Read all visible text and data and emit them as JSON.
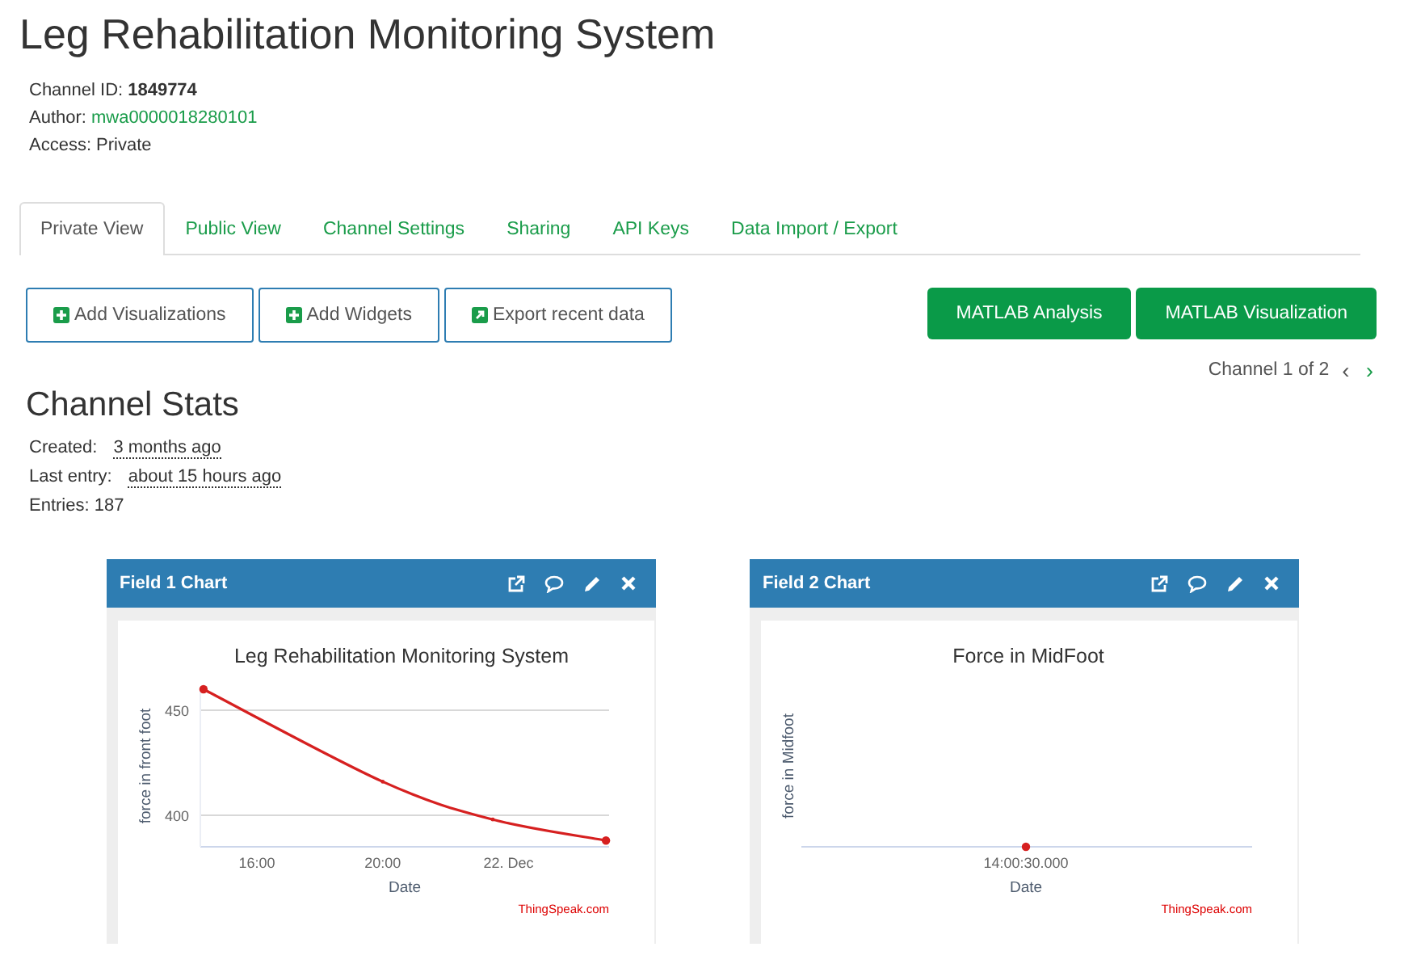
{
  "title": "Leg Rehabilitation Monitoring System",
  "info": [
    {
      "label": "Channel ID:",
      "value": "1849774",
      "kind": "bold"
    },
    {
      "label": "Author:",
      "value": "mwa0000018280101",
      "kind": "link"
    },
    {
      "label": "Access:",
      "value": "Private",
      "kind": "plain"
    }
  ],
  "tabs": [
    {
      "label": "Private View",
      "selected": true
    },
    {
      "label": "Public View",
      "selected": false
    },
    {
      "label": "Channel Settings",
      "selected": false
    },
    {
      "label": "Sharing",
      "selected": false
    },
    {
      "label": "API Keys",
      "selected": false
    },
    {
      "label": "Data Import / Export",
      "selected": false
    }
  ],
  "actions": [
    {
      "label": "Add Visualizations",
      "kind": "plus"
    },
    {
      "label": "Add Widgets",
      "kind": "plus"
    },
    {
      "label": "Export recent data",
      "kind": "export"
    }
  ],
  "matlab_buttons": [
    "MATLAB Analysis",
    "MATLAB Visualization"
  ],
  "pager": {
    "label": "Channel 1 of 2",
    "prev": "‹",
    "next": "›"
  },
  "stats": {
    "heading": "Channel Stats",
    "created_label": "Created:",
    "created": "3 months ago",
    "last_label": "Last entry:",
    "last": "about 15 hours ago",
    "entries": "Entries: 187"
  },
  "panels": [
    {
      "title": "Field 1 Chart",
      "credit": "ThingSpeak.com",
      "chart_data": {
        "type": "line",
        "title": "Leg Rehabilitation Monitoring System",
        "xlabel": "Date",
        "ylabel": "force in front foot",
        "x": [
          14.3,
          20,
          23.5,
          27.1
        ],
        "series": [
          {
            "color": "#d62020",
            "values": [
              460,
              416,
              398,
              388
            ]
          }
        ],
        "xlim": [
          14.2,
          27.2
        ],
        "ylim": [
          385,
          460
        ],
        "xticks": [
          {
            "value": 16,
            "label": "16:00"
          },
          {
            "value": 20,
            "label": "20:00"
          },
          {
            "value": 24,
            "label": "22. Dec"
          }
        ],
        "yticks": [
          400,
          450
        ]
      }
    },
    {
      "title": "Field 2 Chart",
      "credit": "ThingSpeak.com",
      "plot": {
        "title": "Force in MidFoot",
        "xlabel": "Date",
        "ylabel": "force in Midfoot",
        "xtick": "14:00:30.000"
      }
    }
  ]
}
